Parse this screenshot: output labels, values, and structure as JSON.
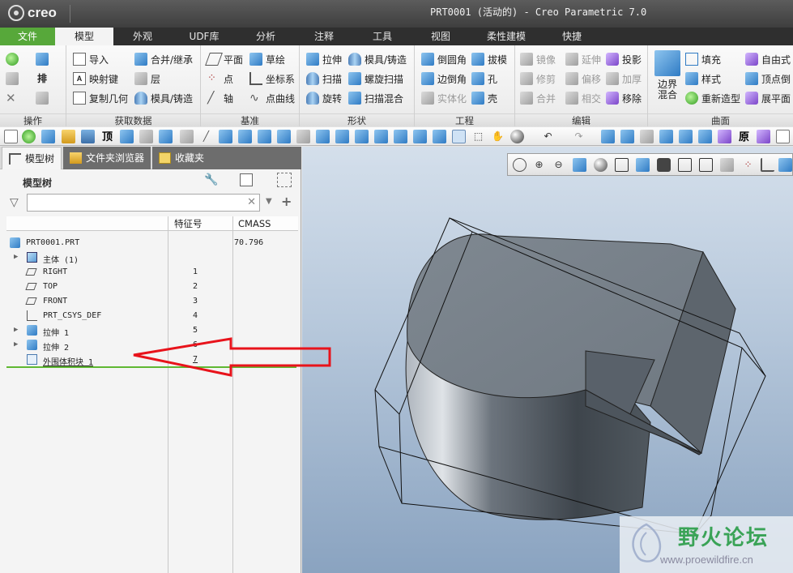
{
  "app": {
    "logo": "creo",
    "title": "PRT0001 (活动的) - Creo Parametric 7.0"
  },
  "ribbon_tabs": [
    {
      "label": "文件",
      "w": 68,
      "kind": "file"
    },
    {
      "label": "模型",
      "w": 72,
      "kind": "active"
    },
    {
      "label": "外观",
      "w": 72,
      "kind": ""
    },
    {
      "label": "UDF库",
      "w": 80,
      "kind": ""
    },
    {
      "label": "分析",
      "w": 72,
      "kind": ""
    },
    {
      "label": "注释",
      "w": 72,
      "kind": ""
    },
    {
      "label": "工具",
      "w": 72,
      "kind": ""
    },
    {
      "label": "视图",
      "w": 72,
      "kind": ""
    },
    {
      "label": "柔性建模",
      "w": 90,
      "kind": ""
    },
    {
      "label": "快捷",
      "w": 72,
      "kind": ""
    }
  ],
  "ribbon": {
    "operations": {
      "label": "操作",
      "regen": "排"
    },
    "get_data": {
      "label": "获取数据",
      "import": "导入",
      "merge": "合并/继承",
      "map_key": "映射键",
      "layer": "层",
      "copy_geom": "复制几何",
      "mold": "模具/铸造"
    },
    "datum": {
      "label": "基准",
      "plane": "平面",
      "sketch": "草绘",
      "point": "点",
      "csys": "坐标系",
      "axis": "轴",
      "curve": "点曲线"
    },
    "shapes": {
      "label": "形状",
      "extrude": "拉伸",
      "mold_cast": "模具/铸造",
      "sweep": "扫描",
      "helical": "螺旋扫描",
      "revolve": "旋转",
      "blend": "扫描混合"
    },
    "engineering": {
      "label": "工程",
      "round": "倒圆角",
      "draft": "拔模",
      "chamfer": "边倒角",
      "hole": "孔",
      "solidify": "实体化",
      "shell": "壳"
    },
    "editing": {
      "label": "编辑",
      "mirror": "镜像",
      "extend": "延伸",
      "project": "投影",
      "trim": "修剪",
      "offset": "偏移",
      "thicken": "加厚",
      "merge": "合并",
      "intersect": "相交",
      "remove": "移除"
    },
    "surfaces": {
      "label": "曲面",
      "boundary": "边界混合",
      "fill": "填充",
      "freeform": "自由式",
      "style": "样式",
      "vertex": "顶点倒",
      "restyle": "重新造型",
      "flatten": "展平面"
    }
  },
  "navigator": {
    "tabs": [
      "模型树",
      "文件夹浏览器",
      "收藏夹"
    ],
    "tree_title": "模型树",
    "columns": {
      "feat_id": "特征号",
      "cmass": "CMASS"
    },
    "rows": [
      {
        "name": "PRT0001.PRT",
        "id": "",
        "mass": "70.796",
        "indent": 0,
        "exp": "",
        "icon": "part"
      },
      {
        "name": "主体 (1)",
        "id": "",
        "mass": "",
        "indent": 1,
        "exp": "▶",
        "icon": "body"
      },
      {
        "name": "RIGHT",
        "id": "1",
        "mass": "",
        "indent": 1,
        "exp": "",
        "icon": "plane"
      },
      {
        "name": "TOP",
        "id": "2",
        "mass": "",
        "indent": 1,
        "exp": "",
        "icon": "plane"
      },
      {
        "name": "FRONT",
        "id": "3",
        "mass": "",
        "indent": 1,
        "exp": "",
        "icon": "plane"
      },
      {
        "name": "PRT_CSYS_DEF",
        "id": "4",
        "mass": "",
        "indent": 1,
        "exp": "",
        "icon": "csys"
      },
      {
        "name": "拉伸 1",
        "id": "5",
        "mass": "",
        "indent": 1,
        "exp": "▶",
        "icon": "extrude"
      },
      {
        "name": "拉伸 2",
        "id": "6",
        "mass": "",
        "indent": 1,
        "exp": "▶",
        "icon": "extrude"
      },
      {
        "name": "外围体积块 1",
        "id": "7",
        "mass": "",
        "indent": 1,
        "exp": "",
        "icon": "bbox"
      }
    ]
  },
  "watermark": {
    "text": "野火论坛",
    "url": "www.proewildfire.cn"
  },
  "colors": {
    "accent_green": "#57a83a",
    "annotation_red": "#e8131b",
    "insert_line": "#5fb832"
  }
}
